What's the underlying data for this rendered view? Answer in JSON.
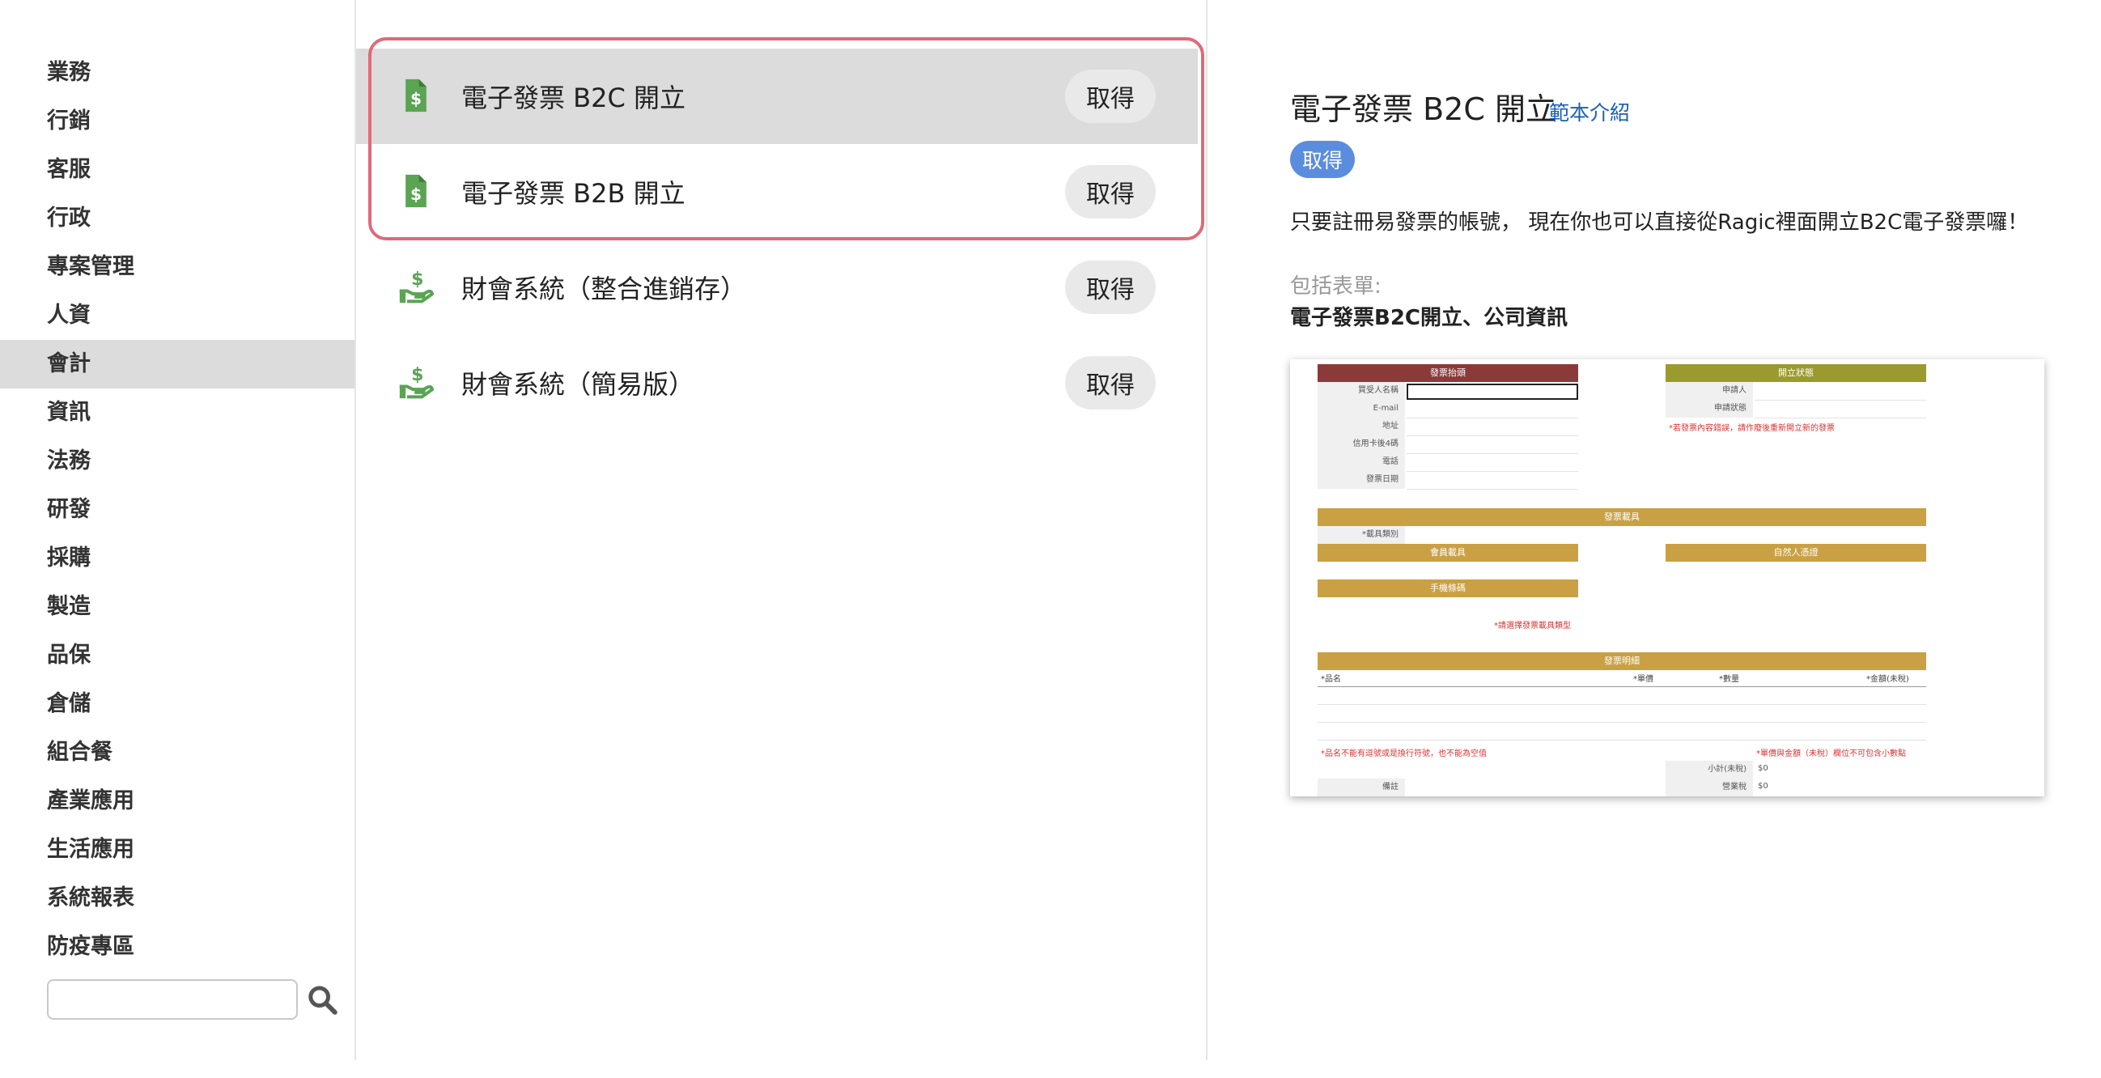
{
  "sidebar": {
    "categories": [
      "業務",
      "行銷",
      "客服",
      "行政",
      "專案管理",
      "人資",
      "會計",
      "資訊",
      "法務",
      "研發",
      "採購",
      "製造",
      "品保",
      "倉儲",
      "組合餐",
      "產業應用",
      "生活應用",
      "系統報表",
      "防疫專區"
    ],
    "active": "會計",
    "search_placeholder": ""
  },
  "templates": [
    {
      "name": "電子發票 B2C 開立",
      "button": "取得",
      "icon": "invoice-dollar-icon"
    },
    {
      "name": "電子發票 B2B 開立",
      "button": "取得",
      "icon": "invoice-dollar-icon"
    },
    {
      "name": "財會系統（整合進銷存）",
      "button": "取得",
      "icon": "hand-dollar-icon"
    },
    {
      "name": "財會系統（簡易版）",
      "button": "取得",
      "icon": "hand-dollar-icon"
    }
  ],
  "detail": {
    "title": "電子發票 B2C 開立",
    "intro_link": "範本介紹",
    "get_button": "取得",
    "description": "只要註冊易發票的帳號， 現在你也可以直接從Ragic裡面開立B2C電子發票囉！",
    "includes_label": "包括表單:",
    "includes_list": "電子發票B2C開立、公司資訊"
  },
  "preview": {
    "sec_invoice_info": "發票抬頭",
    "sec_open_status": "開立狀態",
    "f_buyer": "買受人名稱",
    "f_email": "E-mail",
    "f_address": "地址",
    "f_card4": "信用卡後4碼",
    "f_phone": "電話",
    "f_date": "發票日期",
    "f_applicant": "申請人",
    "f_apply_status": "申請狀態",
    "red_note_1": "*若發票內容錯誤，請作廢後重新開立新的發票",
    "sec_carrier": "發票載具",
    "f_carrier_type": "*載具類別",
    "sec_member": "會員載具",
    "sec_cert": "自然人憑證",
    "sec_mobile": "手機條碼",
    "red_note_2": "*請選擇發票載具類型",
    "sec_detail": "發票明細",
    "col_item": "*品名",
    "col_price": "*單價",
    "col_qty": "*數量",
    "col_amount": "*金額(未稅)",
    "red_note_3": "*品名不能有逗號或是換行符號，也不能為空值",
    "red_note_4": "*單價與金額（未稅）欄位不可包含小數點",
    "f_subtotal": "小計(未稅)",
    "v_subtotal": "$0",
    "f_remark": "備註",
    "f_tax": "營業稅",
    "v_tax": "$0",
    "colors": {
      "maroon": "#8b3a3a",
      "olive": "#9a9a2e",
      "gold": "#c9a044",
      "red": "#dd3333"
    }
  },
  "colors": {
    "accent_blue": "#5b8ddf",
    "link_blue": "#1a5fb4",
    "highlight": "#e06a78",
    "icon_green": "#5aa454"
  }
}
